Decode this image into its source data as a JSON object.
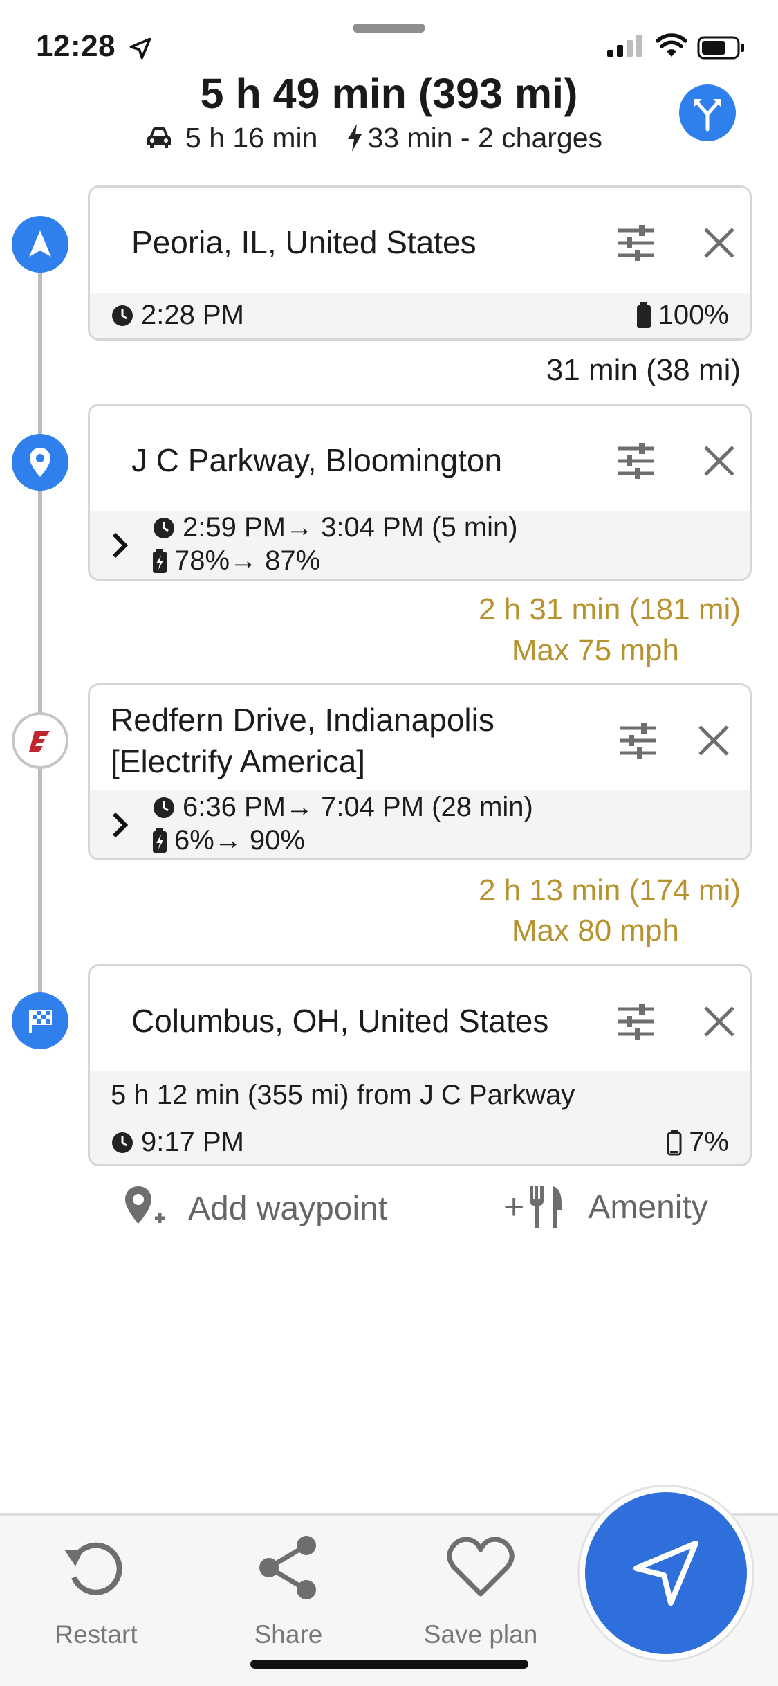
{
  "status_bar": {
    "time": "12:28"
  },
  "header": {
    "title": "5 h 49 min (393 mi)",
    "drive_time": "5 h 16 min",
    "charge_info": "33 min - 2 charges"
  },
  "stops": [
    {
      "title": "Peoria, IL, United States",
      "time": "2:28 PM",
      "battery": "100%"
    },
    {
      "title": "J C Parkway, Bloomington",
      "time": "2:59 PM→ 3:04 PM (5 min)",
      "battery": "78%→ 87%"
    },
    {
      "title_line1": "Redfern Drive, Indianapolis",
      "title_line2": "[Electrify America]",
      "time": "6:36 PM→ 7:04 PM (28 min)",
      "battery": "6%→ 90%"
    },
    {
      "title": "Columbus, OH, United States",
      "subtitle": "5 h 12 min (355 mi) from J C Parkway",
      "time": "9:17 PM",
      "battery": "7%"
    }
  ],
  "legs": [
    {
      "duration": "31 min (38 mi)"
    },
    {
      "duration": "2 h 31 min (181 mi)",
      "speed": "Max 75 mph"
    },
    {
      "duration": "2 h 13 min (174 mi)",
      "speed": "Max 80 mph"
    }
  ],
  "actions": {
    "add_waypoint": "Add waypoint",
    "amenity": "Amenity"
  },
  "bottom_bar": {
    "restart": "Restart",
    "share": "Share",
    "save_plan": "Save plan"
  },
  "colors": {
    "accent": "#2f80ed",
    "leg_gold": "#b8922e",
    "ea_red": "#c0262d"
  },
  "icons": {
    "start": "navigation-arrow-icon",
    "waypoint": "map-pin-icon",
    "charger": "electrify-america-logo",
    "destination": "checkered-flag-icon"
  }
}
